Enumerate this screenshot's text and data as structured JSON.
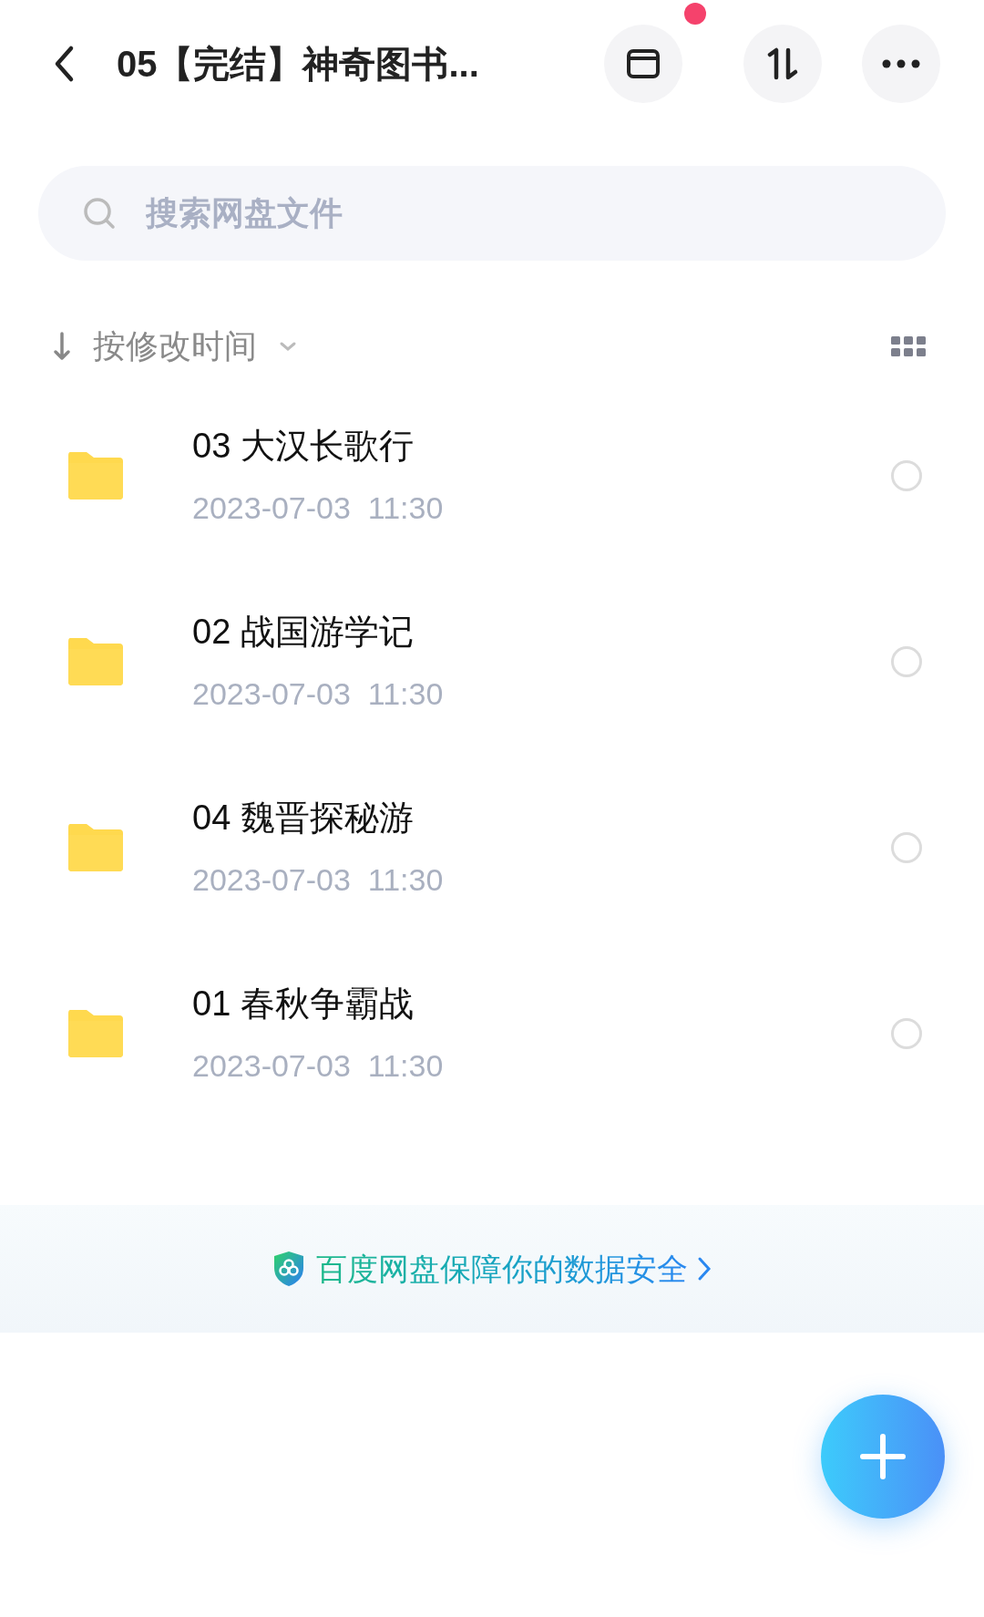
{
  "header": {
    "title": "05【完结】神奇图书..."
  },
  "search": {
    "placeholder": "搜索网盘文件"
  },
  "sort": {
    "label": "按修改时间"
  },
  "files": [
    {
      "name": "03 大汉长歌行",
      "date": "2023-07-03  11:30",
      "selected": false
    },
    {
      "name": "02 战国游学记",
      "date": "2023-07-03  11:30",
      "selected": false
    },
    {
      "name": "04 魏晋探秘游",
      "date": "2023-07-03  11:30",
      "selected": false
    },
    {
      "name": "01 春秋争霸战",
      "date": "2023-07-03  11:30",
      "selected": false
    }
  ],
  "banner": {
    "text": "百度网盘保障你的数据安全"
  }
}
